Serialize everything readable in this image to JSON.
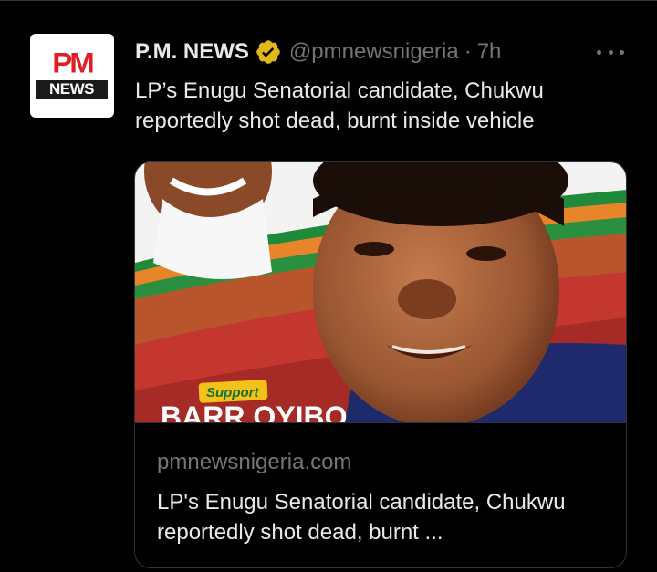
{
  "tweet": {
    "author_name": "P.M. NEWS",
    "handle": "@pmnewsnigeria",
    "separator": "·",
    "time": "7h",
    "text": "LP’s Enugu Senatorial candidate, Chukwu reportedly shot dead, burnt inside vehicle",
    "avatar": {
      "logo_top": "PM",
      "logo_bottom": "NEWS"
    },
    "icons": {
      "verified": "verified-badge-icon",
      "more": "more-options-icon"
    }
  },
  "link_card": {
    "domain": "pmnewsnigeria.com",
    "title": "LP's Enugu Senatorial candidate, Chukwu reportedly shot dead, burnt ...",
    "image": {
      "banner_support": "Support",
      "banner_name": "BARR OYIBO"
    }
  },
  "colors": {
    "background": "#000000",
    "text_primary": "#e7e9ea",
    "text_secondary": "#71767b",
    "border": "#2f3336",
    "verified_gold": "#e2b719",
    "logo_red": "#e01e23"
  }
}
